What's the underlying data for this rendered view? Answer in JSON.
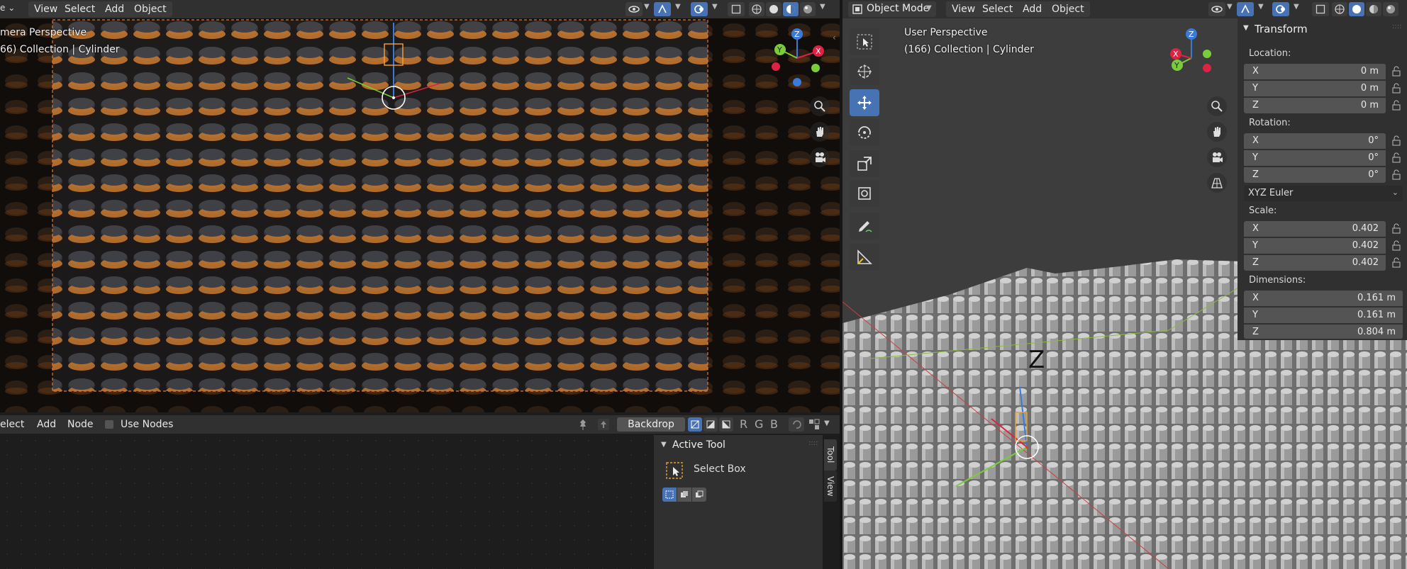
{
  "left_header": {
    "menu": [
      "View",
      "Select",
      "Add",
      "Object"
    ]
  },
  "left_viewport": {
    "overlay_line1": "mera Perspective",
    "overlay_line2": "66) Collection | Cylinder"
  },
  "right_header": {
    "mode": "Object Mode",
    "menu": [
      "View",
      "Select",
      "Add",
      "Object"
    ]
  },
  "right_viewport": {
    "overlay_line1": "User Perspective",
    "overlay_line2": "(166) Collection | Cylinder",
    "label_z": "Z"
  },
  "gizmo": {
    "x": "X",
    "y": "Y",
    "z": "Z"
  },
  "transform_panel": {
    "title": "Transform",
    "location_label": "Location:",
    "location": [
      {
        "axis": "X",
        "value": "0 m"
      },
      {
        "axis": "Y",
        "value": "0 m"
      },
      {
        "axis": "Z",
        "value": "0 m"
      }
    ],
    "rotation_label": "Rotation:",
    "rotation": [
      {
        "axis": "X",
        "value": "0°"
      },
      {
        "axis": "Y",
        "value": "0°"
      },
      {
        "axis": "Z",
        "value": "0°"
      }
    ],
    "rotation_mode": "XYZ Euler",
    "scale_label": "Scale:",
    "scale": [
      {
        "axis": "X",
        "value": "0.402"
      },
      {
        "axis": "Y",
        "value": "0.402"
      },
      {
        "axis": "Z",
        "value": "0.402"
      }
    ],
    "dimensions_label": "Dimensions:",
    "dimensions": [
      {
        "axis": "X",
        "value": "0.161 m"
      },
      {
        "axis": "Y",
        "value": "0.161 m"
      },
      {
        "axis": "Z",
        "value": "0.804 m"
      }
    ]
  },
  "node_editor": {
    "menu_select": "elect",
    "menu_add": "Add",
    "menu_node": "Node",
    "use_nodes": "Use Nodes",
    "backdrop": "Backdrop",
    "channels": [
      "R",
      "G",
      "B"
    ],
    "active_tool_title": "Active Tool",
    "active_tool_name": "Select Box",
    "tab_tool": "Tool",
    "tab_view": "View"
  },
  "colors": {
    "accent": "#4772b3",
    "header": "#303030",
    "panel": "#303030",
    "field": "#545454"
  }
}
